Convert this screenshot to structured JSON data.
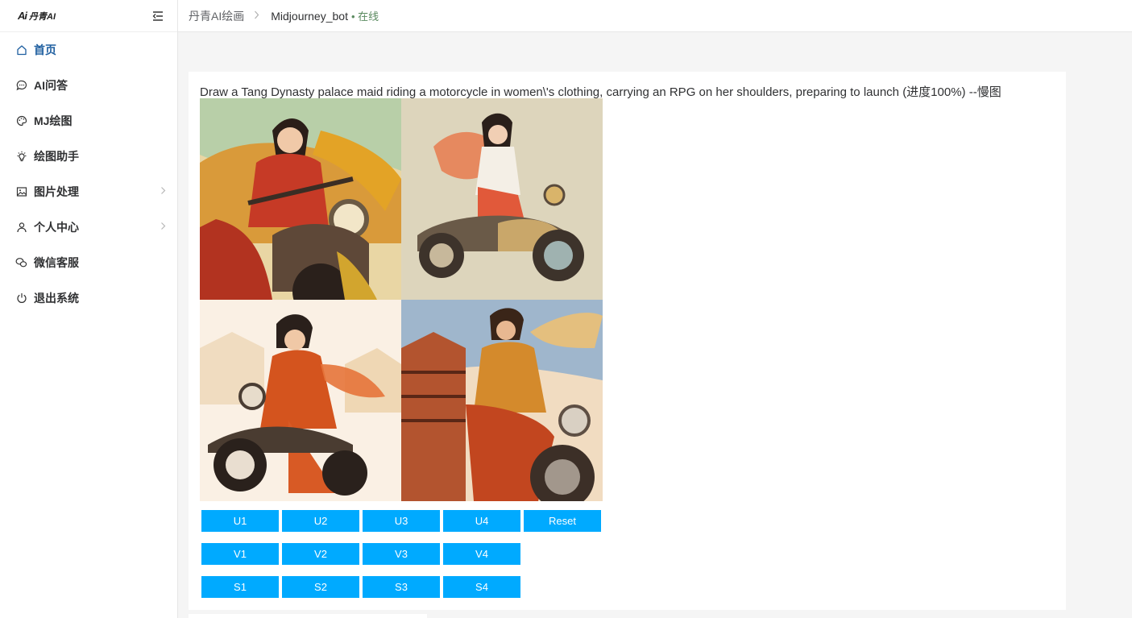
{
  "logo": {
    "mark": "Ai",
    "name": "丹青AI"
  },
  "sidebar": {
    "items": [
      {
        "label": "首页",
        "icon": "home-icon",
        "active": true
      },
      {
        "label": "AI问答",
        "icon": "chat-bubble-icon"
      },
      {
        "label": "MJ绘图",
        "icon": "palette-icon"
      },
      {
        "label": "绘图助手",
        "icon": "lightbulb-icon"
      },
      {
        "label": "图片处理",
        "icon": "image-icon",
        "has_submenu": true
      },
      {
        "label": "个人中心",
        "icon": "user-icon",
        "has_submenu": true
      },
      {
        "label": "微信客服",
        "icon": "wechat-icon"
      },
      {
        "label": "退出系统",
        "icon": "power-icon"
      }
    ]
  },
  "header": {
    "breadcrumb_root": "丹青AI绘画",
    "bot_name": "Midjourney_bot",
    "status": "• 在线"
  },
  "message": {
    "prompt": "Draw a Tang Dynasty palace maid riding a motorcycle in women\\'s clothing, carrying an RPG on her shoulders, preparing to launch (进度100%) --慢图"
  },
  "actions": {
    "upscale": [
      "U1",
      "U2",
      "U3",
      "U4",
      "Reset"
    ],
    "variation": [
      "V1",
      "V2",
      "V3",
      "V4"
    ],
    "sub": [
      "S1",
      "S2",
      "S3",
      "S4"
    ]
  },
  "colors": {
    "button": "#00aaff",
    "active_menu": "#1f5fa0"
  }
}
